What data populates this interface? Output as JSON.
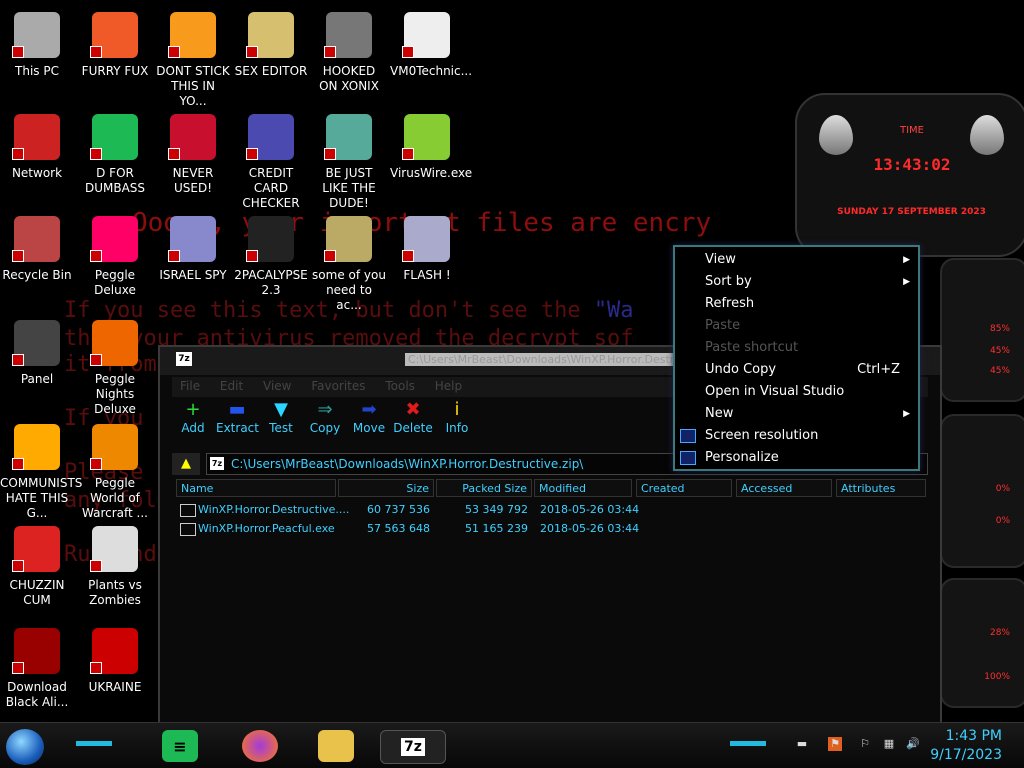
{
  "desktop_icons": [
    {
      "label": "This PC"
    },
    {
      "label": "FURRY FUX"
    },
    {
      "label": "DONT STICK THIS IN YO..."
    },
    {
      "label": "SEX EDITOR"
    },
    {
      "label": "HOOKED ON XONIX"
    },
    {
      "label": "VM0Technic..."
    },
    {
      "label": "Network"
    },
    {
      "label": "D FOR DUMBASS"
    },
    {
      "label": "NEVER USED!"
    },
    {
      "label": "CREDIT CARD CHECKER"
    },
    {
      "label": "BE JUST LIKE THE DUDE!"
    },
    {
      "label": "VirusWire.exe"
    },
    {
      "label": "Recycle Bin"
    },
    {
      "label": "Peggle Deluxe"
    },
    {
      "label": "ISRAEL SPY"
    },
    {
      "label": "2PACALYPSE 2.3"
    },
    {
      "label": "some of you need to ac..."
    },
    {
      "label": "FLASH !"
    },
    {
      "label": "Panel"
    },
    {
      "label": "Peggle Nights Deluxe"
    },
    {
      "label": "COMMUNISTS HATE THIS G..."
    },
    {
      "label": "Peggle World of Warcraft ..."
    },
    {
      "label": "CHUZZIN CUM"
    },
    {
      "label": "Plants vs Zombies"
    },
    {
      "label": "Download Black Ali..."
    },
    {
      "label": "UKRAINE"
    }
  ],
  "ransom": {
    "line1": "Ooops, your important files are encry",
    "line2a": "If you see this text, but don't see the",
    "line2b": "\"Wa",
    "line3": "then your antivirus removed the decrypt sof",
    "line4": "it from",
    "line5": "If you",
    "line6": "Please",
    "line7": "any fol",
    "line8": "Run and"
  },
  "widget": {
    "label": "TIME",
    "time": "13:43:02",
    "date": "SUNDAY 17 SEPTEMBER 2023",
    "gauges": [
      "85%",
      "45%",
      "45%",
      "0%",
      "0%",
      "28%",
      "100%"
    ]
  },
  "window": {
    "title": "C:\\Users\\MrBeast\\Downloads\\WinXP.Horror.Destructive.zip\\",
    "app_icon": "7z",
    "menu": [
      "File",
      "Edit",
      "View",
      "Favorites",
      "Tools",
      "Help"
    ],
    "toolbar": [
      {
        "label": "Add",
        "icon": "+",
        "color": "#2ddc3a"
      },
      {
        "label": "Extract",
        "icon": "▬",
        "color": "#2255ee"
      },
      {
        "label": "Test",
        "icon": "▼",
        "color": "#2ad7ff"
      },
      {
        "label": "Copy",
        "icon": "⇒",
        "color": "#2a9a9a"
      },
      {
        "label": "Move",
        "icon": "➡",
        "color": "#2244cc"
      },
      {
        "label": "Delete",
        "icon": "✖",
        "color": "#e21a1a"
      },
      {
        "label": "Info",
        "icon": "i",
        "color": "#ffd400"
      }
    ],
    "path": "C:\\Users\\MrBeast\\Downloads\\WinXP.Horror.Destructive.zip\\",
    "columns": [
      "Name",
      "Size",
      "Packed Size",
      "Modified",
      "Created",
      "Accessed",
      "Attributes"
    ],
    "files": [
      {
        "name": "WinXP.Horror.Destructive....",
        "size": "60 737 536",
        "packed": "53 349 792",
        "modified": "2018-05-26 03:44"
      },
      {
        "name": "WinXP.Horror.Peacful.exe",
        "size": "57 563 648",
        "packed": "51 165 239",
        "modified": "2018-05-26 03:44"
      }
    ]
  },
  "context_menu": {
    "items": [
      {
        "label": "View",
        "submenu": true,
        "disabled": false
      },
      {
        "label": "Sort by",
        "submenu": true,
        "disabled": false
      },
      {
        "label": "Refresh",
        "disabled": false
      },
      {
        "label": "Paste",
        "disabled": true
      },
      {
        "label": "Paste shortcut",
        "disabled": true
      },
      {
        "label": "Undo Copy",
        "shortcut": "Ctrl+Z",
        "disabled": false
      },
      {
        "label": "Open in Visual Studio",
        "disabled": false
      },
      {
        "label": "New",
        "submenu": true,
        "disabled": false
      },
      {
        "label": "Screen resolution",
        "disabled": false,
        "icon": "display-icon"
      },
      {
        "label": "Personalize",
        "disabled": false,
        "icon": "personalize-icon"
      }
    ]
  },
  "taskbar": {
    "time": "1:43 PM",
    "date": "9/17/2023",
    "pinned": [
      "notes",
      "firefox",
      "file-explorer",
      "7zip"
    ],
    "pinned_7z_label": "7z"
  }
}
